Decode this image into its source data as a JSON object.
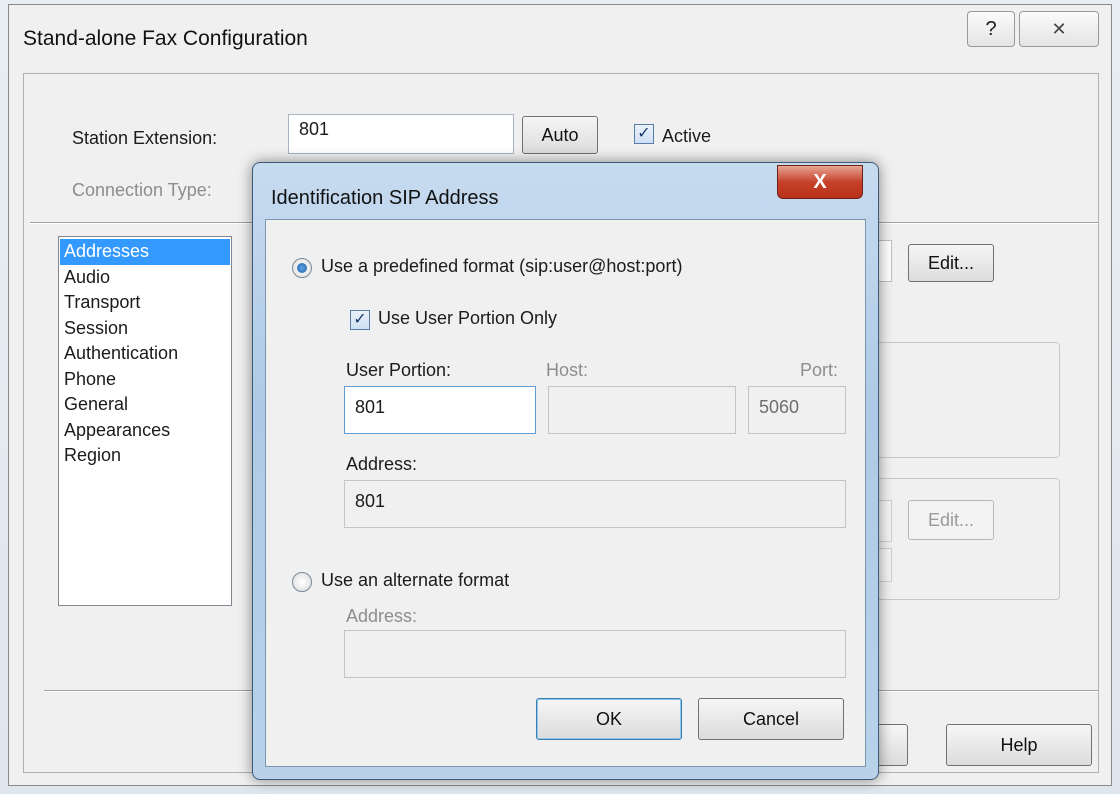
{
  "window": {
    "title": "Stand-alone Fax Configuration",
    "help_glyph": "?",
    "close_glyph": "✕"
  },
  "main": {
    "station_extension_label": "Station Extension:",
    "station_extension_value": "801",
    "auto_button": "Auto",
    "active_label": "Active",
    "active_checked": true,
    "connection_type_label": "Connection Type:",
    "edit_button": "Edit...",
    "edit_button_2": "Edit...",
    "help_button": "Help"
  },
  "sidebar": {
    "items": [
      {
        "label": "Addresses",
        "selected": true
      },
      {
        "label": "Audio"
      },
      {
        "label": "Transport"
      },
      {
        "label": "Session"
      },
      {
        "label": "Authentication"
      },
      {
        "label": "Phone"
      },
      {
        "label": "General"
      },
      {
        "label": "Appearances"
      },
      {
        "label": "Region"
      }
    ]
  },
  "dialog": {
    "title": "Identification SIP Address",
    "close_glyph": "X",
    "predefined_label": "Use a predefined format (sip:user@host:port)",
    "predefined_selected": true,
    "user_portion_only_label": "Use User Portion Only",
    "user_portion_only_checked": true,
    "user_portion_label": "User Portion:",
    "user_portion_value": "801",
    "host_label": "Host:",
    "host_value": "",
    "port_label": "Port:",
    "port_value": "5060",
    "address_label": "Address:",
    "address_value": "801",
    "alternate_label": "Use an alternate format",
    "alternate_address_label": "Address:",
    "alternate_address_value": "",
    "ok_button": "OK",
    "cancel_button": "Cancel"
  },
  "colors": {
    "selection": "#3399ff",
    "dialog_frame": "#aecae6",
    "close_button": "#c7422a"
  }
}
